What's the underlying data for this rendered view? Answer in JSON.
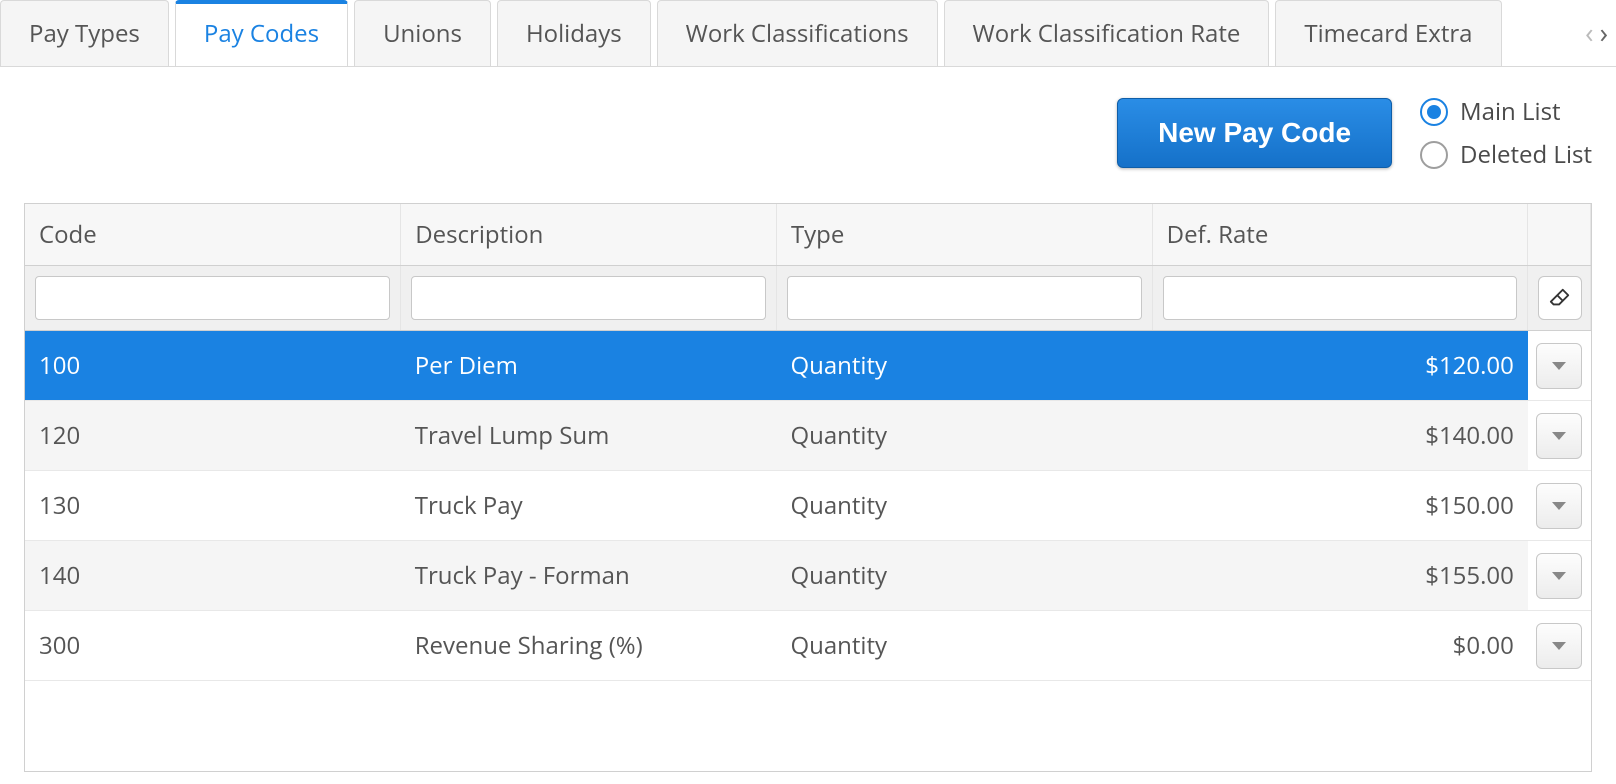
{
  "tabs": {
    "items": [
      {
        "label": "Pay Types",
        "active": false
      },
      {
        "label": "Pay Codes",
        "active": true
      },
      {
        "label": "Unions",
        "active": false
      },
      {
        "label": "Holidays",
        "active": false
      },
      {
        "label": "Work Classifications",
        "active": false
      },
      {
        "label": "Work Classification Rate",
        "active": false
      },
      {
        "label": "Timecard Extra",
        "active": false
      }
    ]
  },
  "toolbar": {
    "new_button_label": "New Pay Code",
    "radios": {
      "main_list": "Main List",
      "deleted_list": "Deleted List",
      "selected": "main_list"
    }
  },
  "table": {
    "columns": {
      "code": "Code",
      "description": "Description",
      "type": "Type",
      "def_rate": "Def. Rate"
    },
    "filters": {
      "code": "",
      "description": "",
      "type": "",
      "def_rate": ""
    },
    "rows": [
      {
        "code": "100",
        "description": "Per Diem",
        "type": "Quantity",
        "def_rate": "$120.00",
        "selected": true
      },
      {
        "code": "120",
        "description": "Travel Lump Sum",
        "type": "Quantity",
        "def_rate": "$140.00",
        "selected": false
      },
      {
        "code": "130",
        "description": "Truck Pay",
        "type": "Quantity",
        "def_rate": "$150.00",
        "selected": false
      },
      {
        "code": "140",
        "description": "Truck Pay - Forman",
        "type": "Quantity",
        "def_rate": "$155.00",
        "selected": false
      },
      {
        "code": "300",
        "description": "Revenue Sharing (%)",
        "type": "Quantity",
        "def_rate": "$0.00",
        "selected": false
      }
    ]
  }
}
